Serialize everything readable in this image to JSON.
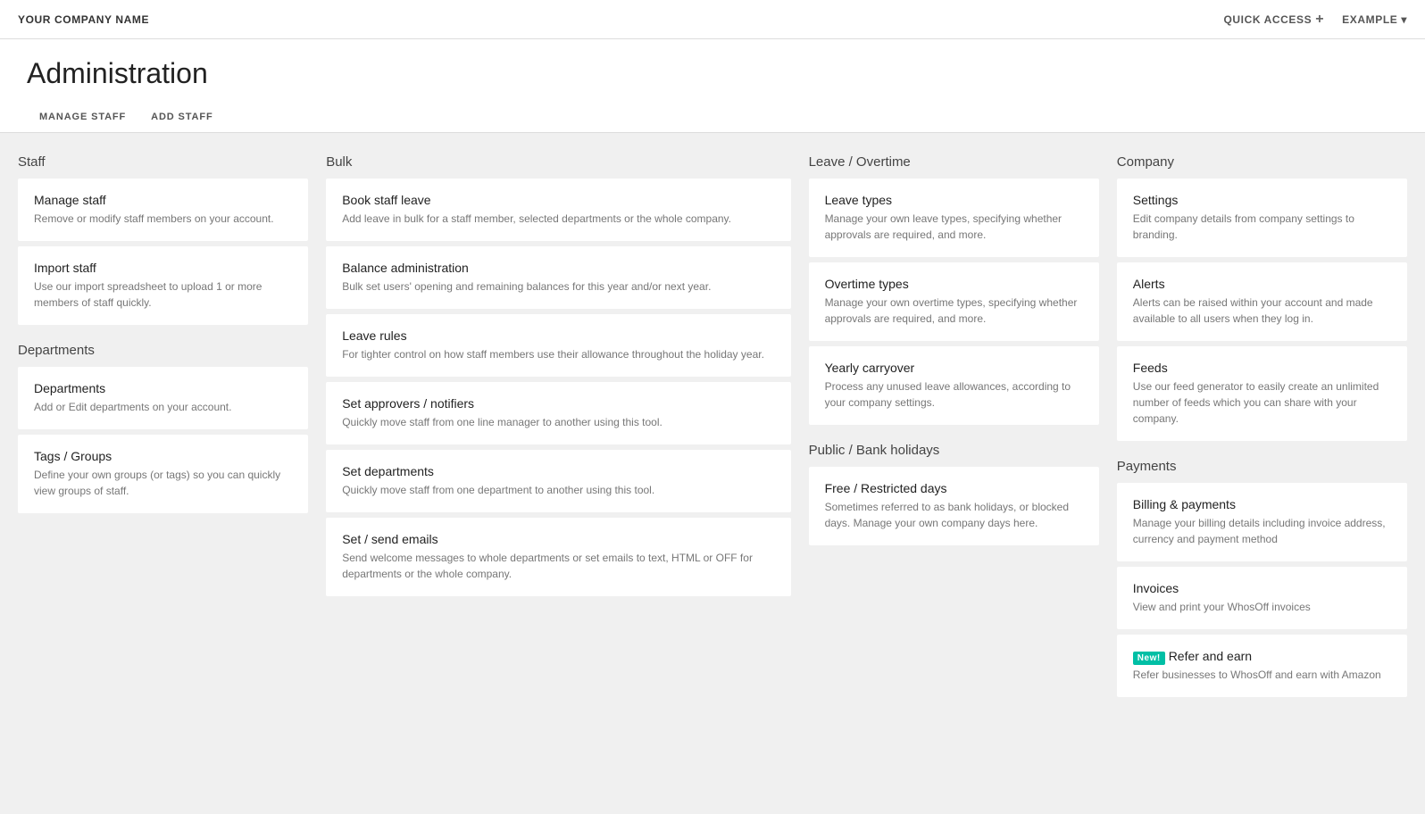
{
  "topnav": {
    "company_name": "YOUR COMPANY NAME",
    "quick_access_label": "QUICK ACCESS",
    "quick_access_plus": "+",
    "example_label": "EXAMPLE",
    "chevron": "▾"
  },
  "header": {
    "title": "Administration",
    "tabs": [
      {
        "label": "MANAGE STAFF"
      },
      {
        "label": "ADD STAFF"
      }
    ]
  },
  "columns": {
    "staff": {
      "section_title": "Staff",
      "cards": [
        {
          "title": "Manage staff",
          "desc": "Remove or modify staff members on your account."
        },
        {
          "title": "Import staff",
          "desc": "Use our import spreadsheet to upload 1 or more members of staff quickly."
        }
      ],
      "departments_title": "Departments",
      "departments_cards": [
        {
          "title": "Departments",
          "desc": "Add or Edit departments on your account."
        },
        {
          "title": "Tags / Groups",
          "desc": "Define your own groups (or tags) so you can quickly view groups of staff."
        }
      ]
    },
    "bulk": {
      "section_title": "Bulk",
      "cards": [
        {
          "title": "Book staff leave",
          "desc": "Add leave in bulk for a staff member, selected departments or the whole company."
        },
        {
          "title": "Balance administration",
          "desc": "Bulk set users' opening and remaining balances for this year and/or next year."
        },
        {
          "title": "Leave rules",
          "desc": "For tighter control on how staff members use their allowance throughout the holiday year."
        },
        {
          "title": "Set approvers / notifiers",
          "desc": "Quickly move staff from one line manager to another using this tool."
        },
        {
          "title": "Set departments",
          "desc": "Quickly move staff from one department to another using this tool."
        },
        {
          "title": "Set / send emails",
          "desc": "Send welcome messages to whole departments or set emails to text, HTML or OFF for departments or the whole company."
        }
      ]
    },
    "leave_overtime": {
      "section_title": "Leave / Overtime",
      "cards": [
        {
          "title": "Leave types",
          "desc": "Manage your own leave types, specifying whether approvals are required, and more."
        },
        {
          "title": "Overtime types",
          "desc": "Manage your own overtime types, specifying whether approvals are required, and more."
        },
        {
          "title": "Yearly carryover",
          "desc": "Process any unused leave allowances, according to your company settings."
        }
      ],
      "public_holidays_title": "Public / Bank holidays",
      "public_holidays_cards": [
        {
          "title": "Free / Restricted days",
          "desc": "Sometimes referred to as bank holidays, or blocked days. Manage your own company days here."
        }
      ]
    },
    "company": {
      "section_title": "Company",
      "cards": [
        {
          "title": "Settings",
          "desc": "Edit company details from company settings to branding."
        },
        {
          "title": "Alerts",
          "desc": "Alerts can be raised within your account and made available to all users when they log in."
        },
        {
          "title": "Feeds",
          "desc": "Use our feed generator to easily create an unlimited number of feeds which you can share with your company."
        }
      ],
      "payments_title": "Payments",
      "payments_cards": [
        {
          "title": "Billing & payments",
          "desc": "Manage your billing details including invoice address, currency and payment method"
        },
        {
          "title": "Invoices",
          "desc": "View and print your WhosOff invoices"
        },
        {
          "title": "Refer and earn",
          "desc": "Refer businesses to WhosOff and earn with Amazon",
          "badge": "New!"
        }
      ]
    }
  }
}
